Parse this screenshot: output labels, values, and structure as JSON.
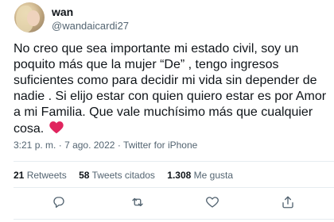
{
  "user": {
    "name": "wan",
    "handle": "@wandaicardi27"
  },
  "tweet": {
    "text": "No creo que sea importante mi estado civil, soy un poquito más que la mujer “De” , tengo ingresos suficientes como para decidir mi vida sin depender de nadie . Si elijo estar con quien quiero estar es por Amor a mi Familia. Que vale muchísimo más que cualquier cosa.",
    "emoji_icon": "red-heart-icon",
    "heart_color": "#e0245e"
  },
  "meta": {
    "time": "3:21 p. m.",
    "separator": "·",
    "date": "7 ago. 2022",
    "source": "Twitter for iPhone"
  },
  "stats": {
    "retweets_count": "21",
    "retweets_label": "Retweets",
    "quotes_count": "58",
    "quotes_label": "Tweets citados",
    "likes_count": "1.308",
    "likes_label": "Me gusta"
  },
  "actions": {
    "reply_icon": "reply-icon",
    "retweet_icon": "retweet-icon",
    "like_icon": "heart-icon",
    "share_icon": "share-icon",
    "icon_color": "#536471"
  }
}
